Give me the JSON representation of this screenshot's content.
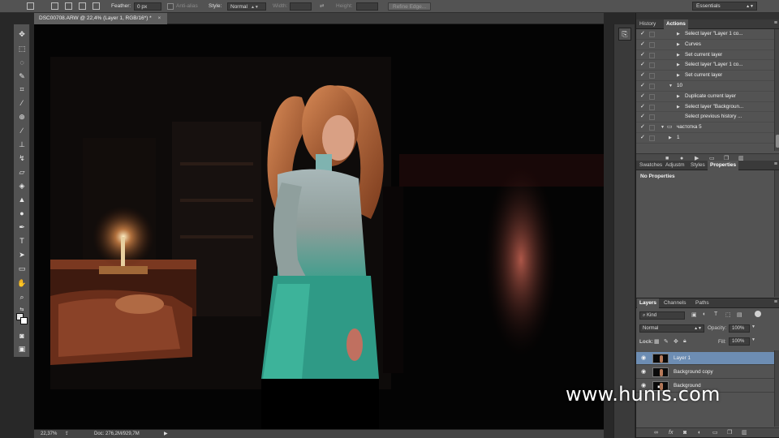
{
  "options_bar": {
    "feather_label": "Feather:",
    "feather_value": "0 px",
    "anti_alias_label": "Anti-alias",
    "style_label": "Style:",
    "style_value": "Normal",
    "width_label": "Width:",
    "height_label": "Height:",
    "refine_edge_label": "Refine Edge...",
    "workspace_value": "Essentials"
  },
  "document": {
    "tab_title": "DSC00708.ARW @ 22,4% (Layer 1, RGB/16*) *",
    "close_glyph": "×"
  },
  "status": {
    "zoom": "22,37%",
    "doc_info": "Doc: 276,2M/929,7M",
    "arrow": "▶"
  },
  "history_actions_panel": {
    "tabs": [
      "History",
      "Actions"
    ],
    "active_tab": "Actions",
    "rows": [
      {
        "label": "Select layer \"Layer 1 co...",
        "indent": 3,
        "expander": "▶"
      },
      {
        "label": "Curves",
        "indent": 3,
        "expander": "▶"
      },
      {
        "label": "Set current layer",
        "indent": 3,
        "expander": "▶"
      },
      {
        "label": "Select layer \"Layer 1 co...",
        "indent": 3,
        "expander": "▶"
      },
      {
        "label": "Set current layer",
        "indent": 3,
        "expander": "▶"
      },
      {
        "label": "10",
        "indent": 2,
        "expander": "▼"
      },
      {
        "label": "Duplicate current layer",
        "indent": 3,
        "expander": "▶"
      },
      {
        "label": "Select layer \"Backgroun...",
        "indent": 3,
        "expander": "▶"
      },
      {
        "label": "Select previous history ...",
        "indent": 3,
        "expander": ""
      },
      {
        "label": "частотка 5",
        "indent": 1,
        "expander": "▼",
        "folder": true
      },
      {
        "label": "1",
        "indent": 2,
        "expander": "▶"
      }
    ]
  },
  "properties_panel": {
    "tabs": [
      "Swatches",
      "Adjustm",
      "Styles",
      "Properties"
    ],
    "active_tab": "Properties",
    "empty_text": "No Properties"
  },
  "layers_panel": {
    "tabs": [
      "Layers",
      "Channels",
      "Paths"
    ],
    "active_tab": "Layers",
    "filter_value": "Kind",
    "blend_mode": "Normal",
    "opacity_label": "Opacity:",
    "opacity_value": "100%",
    "lock_label": "Lock:",
    "fill_label": "Fill:",
    "fill_value": "100%",
    "layers": [
      {
        "name": "Layer 1",
        "selected": true
      },
      {
        "name": "Background copy",
        "selected": false
      },
      {
        "name": "Background",
        "selected": false
      }
    ]
  },
  "watermark": "www.hunis.com",
  "colors": {
    "ui_dark": "#323232",
    "ui_mid": "#535353",
    "layer_selected": "#6d8db3"
  },
  "icons": {
    "check": "✓",
    "eye": "◉",
    "panel_menu": "≡"
  }
}
